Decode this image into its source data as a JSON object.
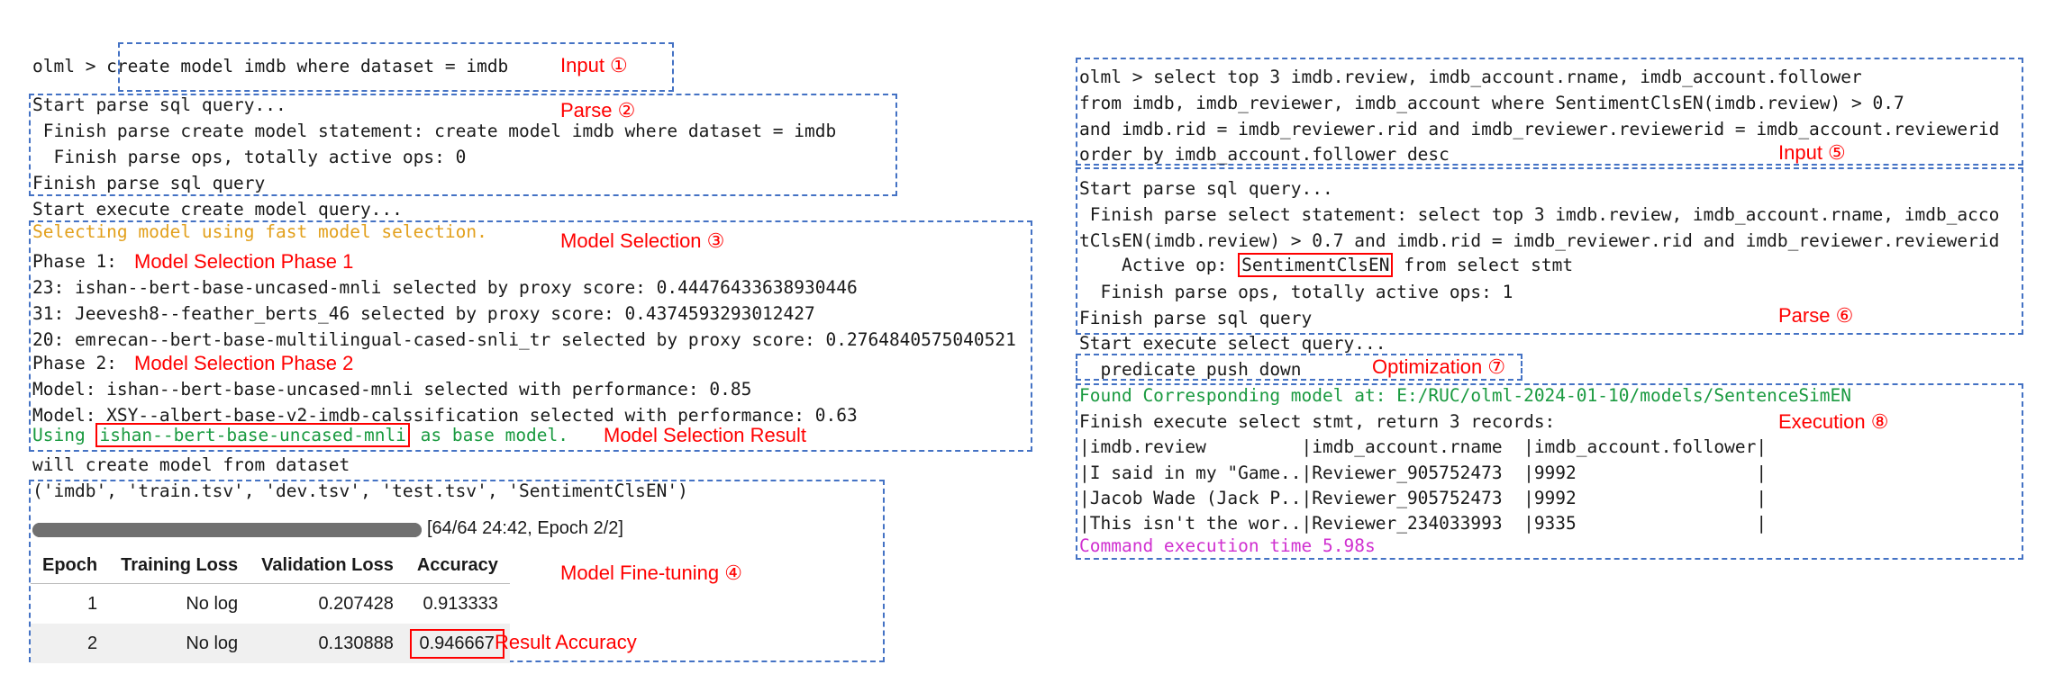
{
  "left": {
    "input_line": "olml > create model imdb where dataset = imdb",
    "input_label": "Input ①",
    "parse_lines": [
      "Start parse sql query...",
      " Finish parse create model statement: create model imdb where dataset = imdb",
      "  Finish parse ops, totally active ops: 0",
      "Finish parse sql query"
    ],
    "parse_label": "Parse ②",
    "execute_line": "Start execute create model query...",
    "selecting_line": "Selecting model using fast model selection.",
    "model_selection_label": "Model Selection ③",
    "phase1_prefix": "Phase 1:",
    "phase1_label": "Model Selection Phase 1",
    "phase1_lines": [
      "23: ishan--bert-base-uncased-mnli selected by proxy score: 0.44476433638930446",
      "31: Jeevesh8--feather_berts_46 selected by proxy score: 0.4374593293012427",
      "20: emrecan--bert-base-multilingual-cased-snli_tr selected by proxy score: 0.2764840575040521"
    ],
    "phase2_prefix": "Phase 2:",
    "phase2_label": "Model Selection Phase 2",
    "phase2_lines": [
      "Model: ishan--bert-base-uncased-mnli selected with performance: 0.85",
      "Model: XSY--albert-base-v2-imdb-calssification selected with performance: 0.63"
    ],
    "using_prefix": "Using ",
    "using_model": "ishan--bert-base-uncased-mnli",
    "using_suffix": " as base model.",
    "selection_result_label": "Model Selection Result",
    "will_create_line": "will create model from dataset",
    "dataset_tuple": "('imdb', 'train.tsv', 'dev.tsv', 'test.tsv', 'SentimentClsEN')",
    "progress": {
      "fraction": 1.0,
      "text": "[64/64 24:42, Epoch 2/2]"
    },
    "table": {
      "headers": [
        "Epoch",
        "Training Loss",
        "Validation Loss",
        "Accuracy"
      ],
      "rows": [
        [
          "1",
          "No log",
          "0.207428",
          "0.913333"
        ],
        [
          "2",
          "No log",
          "0.130888",
          "0.946667"
        ]
      ]
    },
    "finetune_label": "Model Fine-tuning ④",
    "result_accuracy_label": "Result Accuracy"
  },
  "right": {
    "input_lines": [
      "olml > select top 3 imdb.review, imdb_account.rname, imdb_account.follower",
      "from imdb, imdb_reviewer, imdb_account where SentimentClsEN(imdb.review) > 0.7",
      "and imdb.rid = imdb_reviewer.rid and imdb_reviewer.reviewerid = imdb_account.reviewerid",
      "order by imdb_account.follower desc"
    ],
    "input_label": "Input ⑤",
    "parse_lines": [
      "Start parse sql query...",
      " Finish parse select statement: select top 3 imdb.review, imdb_account.rname, imdb_acco",
      "tClsEN(imdb.review) > 0.7 and imdb.rid = imdb_reviewer.rid and imdb_reviewer.reviewerid"
    ],
    "active_op_prefix": "    Active op: ",
    "active_op": "SentimentClsEN",
    "active_op_suffix": " from select stmt",
    "parse_lines_2": [
      "  Finish parse ops, totally active ops: 1",
      "Finish parse sql query"
    ],
    "parse_label": "Parse ⑥",
    "execute_line": "Start execute select query...",
    "pushdown_line": "  predicate push down",
    "optimization_label": "Optimization ⑦",
    "found_model_line": "Found Corresponding model at: E:/RUC/olml-2024-01-10/models/SentenceSimEN",
    "finish_execute_line": "Finish execute select stmt, return 3 records:",
    "execution_label": "Execution ⑧",
    "result_lines": [
      "|imdb.review         |imdb_account.rname  |imdb_account.follower|",
      "|I said in my \"Game..|Reviewer_905752473  |9992                 |",
      "|Jacob Wade (Jack P..|Reviewer_905752473  |9992                 |",
      "|This isn't the wor..|Reviewer_234033993  |9335                 |"
    ],
    "exec_time_line": "Command execution time 5.98s"
  },
  "colors": {
    "box_border": "#4472c4",
    "label_red": "#ff0000",
    "green_text": "#1a9a40",
    "orange_text": "#e2a01c",
    "magenta_text": "#d030d0"
  }
}
